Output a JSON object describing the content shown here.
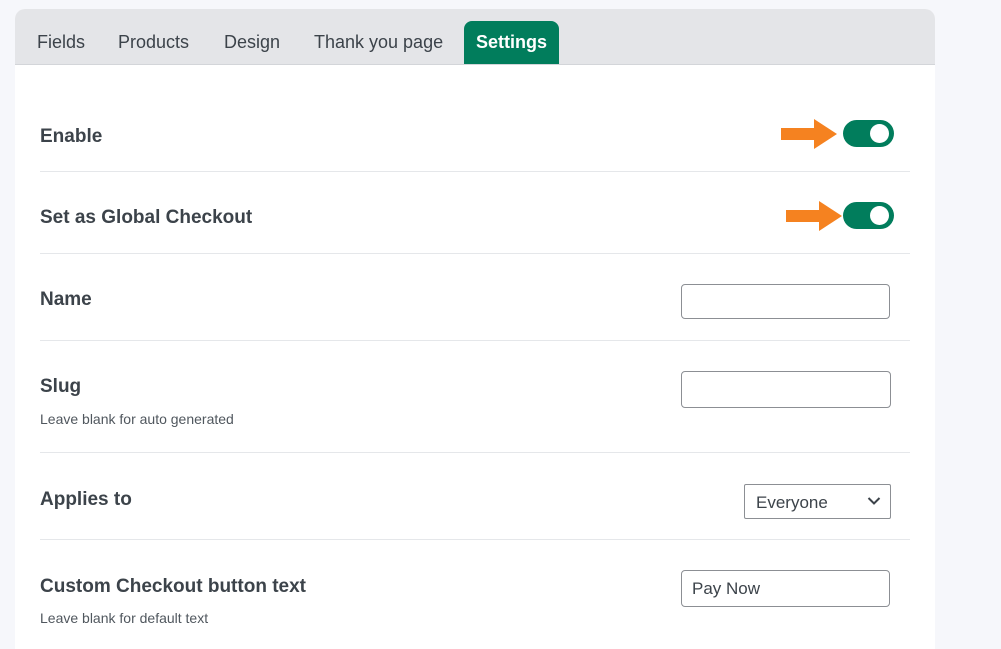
{
  "tabs": [
    {
      "label": "Fields",
      "active": false
    },
    {
      "label": "Products",
      "active": false
    },
    {
      "label": "Design",
      "active": false
    },
    {
      "label": "Thank you page",
      "active": false
    },
    {
      "label": "Settings",
      "active": true
    }
  ],
  "colors": {
    "accent": "#017d5c",
    "arrow": "#f58220",
    "tabbar_bg": "#e4e5e8"
  },
  "settings": {
    "enable": {
      "label": "Enable",
      "toggle_on": true
    },
    "global_checkout": {
      "label": "Set as Global Checkout",
      "toggle_on": true
    },
    "name": {
      "label": "Name",
      "value": ""
    },
    "slug": {
      "label": "Slug",
      "hint": "Leave blank for auto generated",
      "value": ""
    },
    "applies_to": {
      "label": "Applies to",
      "selected": "Everyone"
    },
    "checkout_button": {
      "label": "Custom Checkout button text",
      "hint": "Leave blank for default text",
      "value": "Pay Now"
    }
  }
}
